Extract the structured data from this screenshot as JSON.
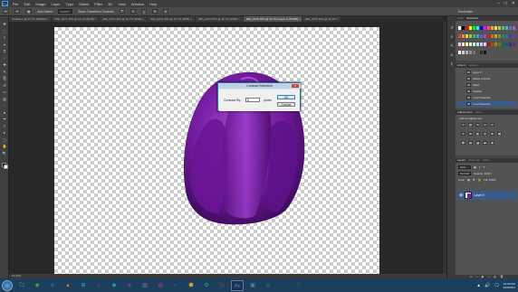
{
  "app": {
    "logo": "Ps"
  },
  "menu": [
    "File",
    "Edit",
    "Image",
    "Layer",
    "Type",
    "Select",
    "Filter",
    "3D",
    "View",
    "Window",
    "Help"
  ],
  "window_controls": [
    "–",
    "□",
    "✕"
  ],
  "options_bar": {
    "tool_icon": "magic-wand-icon",
    "add_select_label": "Add Select",
    "feather_field": "Feather",
    "show_transform_label": "Show Transform Controls",
    "workspace_label": "Essentials"
  },
  "tabs": [
    {
      "label": "Untitled-1 @ 66.7% (RGB/8) ×",
      "active": false
    },
    {
      "label": "IMG_0271.JPG @ 16.7% (RGB) ×",
      "active": false
    },
    {
      "label": "IMG_0272.JPG @ 16.7% (RGB) ×",
      "active": false
    },
    {
      "label": "IMG_0273.JPG @ 16.7% (RGB) ×",
      "active": false
    },
    {
      "label": "IMG_0274.JPG @ 16.7% (RGB) ×",
      "active": false
    },
    {
      "label": "IMG_0275.JPG @ 16.7% (Layer 0, RGB/8) ×",
      "active": true
    },
    {
      "label": "IMG_0276.JPG @ 16.7% ×",
      "active": false
    }
  ],
  "tools": [
    "move-icon",
    "marquee-icon",
    "lasso-icon",
    "magic-wand-icon",
    "crop-icon",
    "eyedropper-icon",
    "healing-icon",
    "brush-icon",
    "clone-stamp-icon",
    "history-brush-icon",
    "eraser-icon",
    "gradient-icon",
    "blur-icon",
    "dodge-icon",
    "pen-icon",
    "type-icon",
    "path-select-icon",
    "shape-icon",
    "hand-icon",
    "zoom-icon"
  ],
  "tool_glyphs": [
    "✥",
    "⬚",
    "ℓ",
    "✦",
    "⌗",
    "⟋",
    "✚",
    "✎",
    "⎘",
    "↺",
    "▭",
    "▤",
    "◌",
    "●",
    "✒",
    "T",
    "▸",
    "▢",
    "✋",
    "🔍"
  ],
  "dialog": {
    "title": "Contract Selection",
    "label": "Contract By:",
    "value": "5",
    "unit": "pixels",
    "ok_label": "OK",
    "cancel_label": "Cancel",
    "close_label": "✕"
  },
  "status": "16.67%",
  "panels": {
    "swatch_tabs": [
      "Color",
      "Swatches"
    ],
    "history_tabs": [
      "History",
      "Actions"
    ],
    "history_items": [
      "Layer 0",
      "Select Canvas",
      "Mask",
      "Feather",
      "Load Selection",
      "Load Selection"
    ],
    "adjust_tabs": [
      "Adjustments",
      "Styles"
    ],
    "adjust_title": "Add an adjustment",
    "layer_tabs": [
      "Layers",
      "Channels",
      "Paths"
    ],
    "layer_kind": "Kind",
    "layer_mode": "Normal",
    "opacity_label": "Opacity: 100%",
    "lock_label": "Lock:",
    "fill_label": "Fill: 100%",
    "layer_name": "Layer 0",
    "layer_footer": [
      "fx",
      "◐",
      "▣",
      "▢",
      "▥",
      "🗑"
    ]
  },
  "swatch_colors": [
    "#ffffff",
    "#000000",
    "#ff0000",
    "#ffff00",
    "#00ff00",
    "#00ffff",
    "#0000ff",
    "#ff00ff",
    "#f25a5a",
    "#f0a050",
    "#f5e050",
    "#a0d050",
    "#50c080",
    "#50b0d0",
    "#6070d0",
    "#b060c0",
    "#e84040",
    "#e89030",
    "#e8d030",
    "#90c840",
    "#40b070",
    "#40a0c8",
    "#5060c8",
    "#a050b8",
    "#c02828",
    "#c07020",
    "#c0a820",
    "#70a028",
    "#288858",
    "#287898",
    "#3848a0",
    "#803898",
    "#f8c8c8",
    "#f8e0c0",
    "#f8f0c0",
    "#e0f0c0",
    "#c0f0d8",
    "#c0e0f0",
    "#c8d0f0",
    "#e8c8f0",
    "#a01818",
    "#a05010",
    "#a08810",
    "#508018",
    "#186840",
    "#185878",
    "#283080",
    "#602878",
    "#f0f0f0",
    "#d0d0d0",
    "#b0b0b0",
    "#909090",
    "#707070",
    "#505050",
    "#303030",
    "#181818"
  ],
  "taskbar": {
    "apps": [
      "explorer",
      "chrome",
      "ie",
      "vlc",
      "store",
      "media",
      "app1",
      "app2",
      "calc",
      "app3",
      "app4",
      "app5",
      "app6",
      "app7",
      "ps",
      "app8",
      "app9",
      "steam",
      "app10"
    ],
    "app_glyphs": [
      "🗀",
      "◉",
      "e",
      "▲",
      "⊞",
      "♫",
      "◆",
      "◈",
      "▦",
      "◍",
      "◐",
      "⬢",
      "✿",
      "◷",
      "Ps",
      "▣",
      "◎",
      "⚙",
      "☰"
    ],
    "app_colors": [
      "#e8b848",
      "#4aa048",
      "#2a78d0",
      "#e87818",
      "#3a9ad8",
      "#d04040",
      "#2aa0a0",
      "#8040a0",
      "#707070",
      "#c04080",
      "#4060c0",
      "#d0a020",
      "#20a060",
      "#a05020",
      "#1c2f54",
      "#6080a0",
      "#408040",
      "#2a3a5a",
      "#505050"
    ],
    "active_index": 14,
    "tray": [
      "▲",
      "🔊",
      "🗨"
    ],
    "time": "12:33 PM",
    "date": "4/25/2017"
  }
}
